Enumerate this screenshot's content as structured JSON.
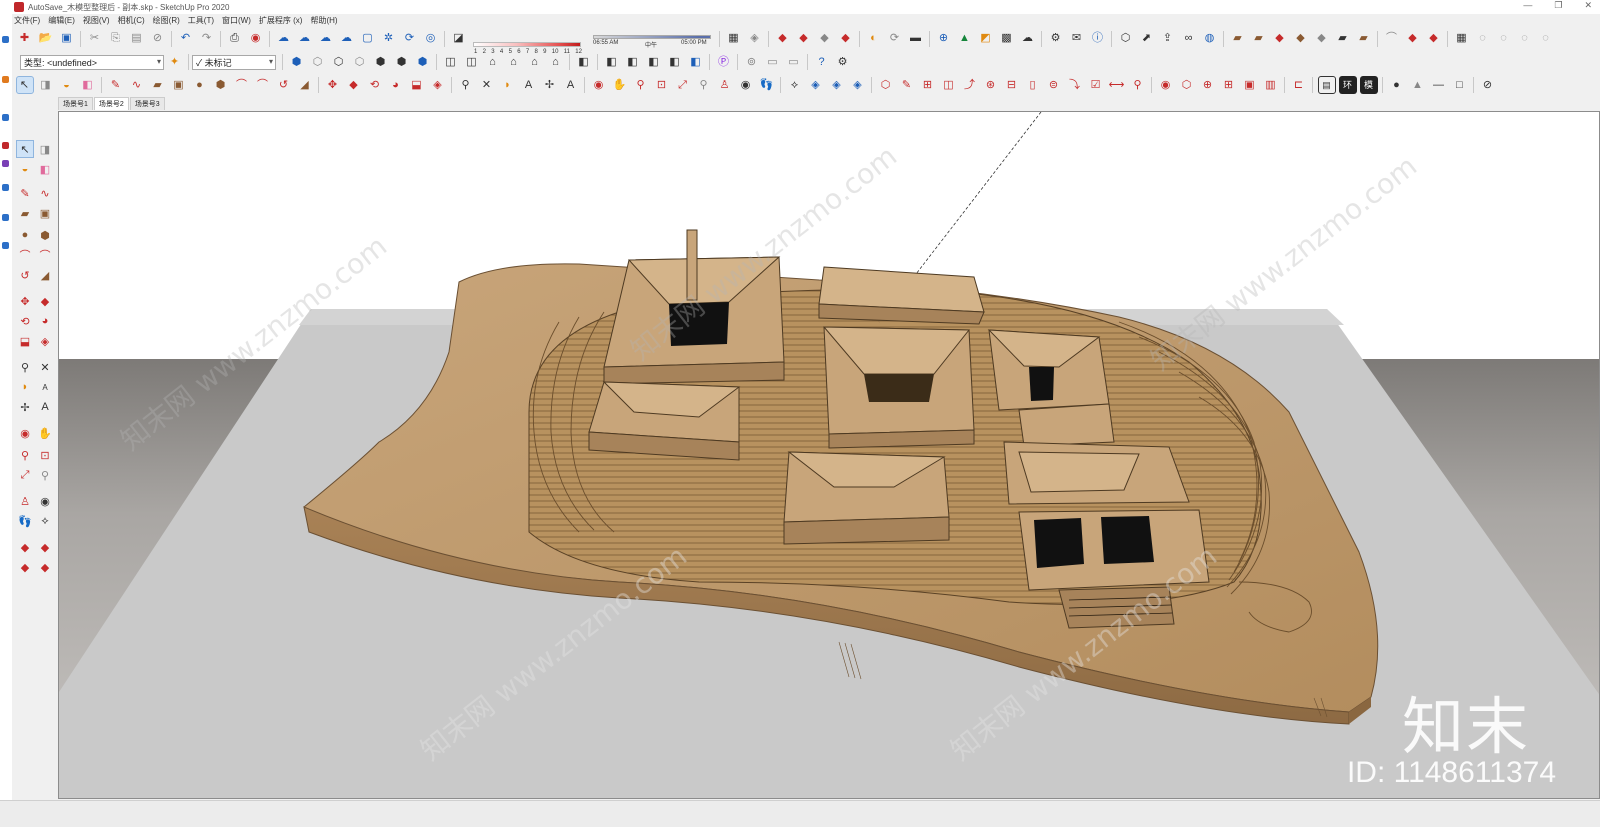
{
  "window": {
    "title": "AutoSave_木模型整理后 - 副本.skp - SketchUp Pro 2020",
    "controls": [
      "—",
      "❐",
      "✕"
    ]
  },
  "menu": [
    "文件(F)",
    "编辑(E)",
    "视图(V)",
    "相机(C)",
    "绘图(R)",
    "工具(T)",
    "窗口(W)",
    "扩展程序 (x)",
    "帮助(H)"
  ],
  "shadow": {
    "month_scale": [
      "1",
      "2",
      "3",
      "4",
      "5",
      "6",
      "7",
      "8",
      "9",
      "10",
      "11",
      "12"
    ],
    "time_start": "06:55 AM",
    "time_mid": "中午",
    "time_end": "05:00 PM"
  },
  "tags": {
    "type_dropdown": "类型: <undefined>",
    "tag_dropdown": "✓ 未标记"
  },
  "scenes": [
    "场景号1",
    "场景号2",
    "场景号3"
  ],
  "active_scene": "场景号2",
  "toolbar_text_buttons": [
    "环",
    "模"
  ],
  "watermark": {
    "logo": "知末",
    "id": "ID: 1148611374",
    "diagonal": "知末网 www.znzmo.com"
  },
  "colors": {
    "wood": "#c8a57a",
    "wood_dark": "#8d6a43",
    "ground": "#c9c9c9",
    "sky": "#ffffff"
  },
  "icons": {
    "toolbar1": [
      "new-icon",
      "open-icon",
      "save-icon",
      "cut-icon",
      "copy-icon",
      "paste-icon",
      "erase-icon",
      "undo-icon",
      "redo-icon",
      "print-icon",
      "model-info-icon",
      "cloud-icon",
      "cloud2-icon",
      "cloud3-icon",
      "cloud4-icon",
      "select-box-icon",
      "gear-icon",
      "chrome-icon",
      "eraser-icon"
    ],
    "left": [
      "select-icon",
      "make-component-icon",
      "paint-icon",
      "eraser-icon",
      "pencil-icon",
      "freehand-icon",
      "rectangle-icon",
      "rotated-rect-icon",
      "circle-icon",
      "polygon-icon",
      "arc-icon",
      "arc2-icon",
      "pie-icon",
      "arc3-icon",
      "move-icon",
      "push-pull-icon",
      "rotate-icon",
      "follow-me-icon",
      "scale-icon",
      "offset-icon",
      "tape-icon",
      "text-icon",
      "protractor-icon",
      "axes-icon",
      "dimension-icon",
      "section-icon",
      "orbit-icon",
      "pan-icon",
      "zoom-icon",
      "zoom-window-icon",
      "zoom-extents-icon",
      "prev-icon",
      "walk-icon",
      "look-around-icon",
      "position-camera-icon",
      "footprints-icon",
      "section-plane-icon",
      "warehouse-icon",
      "extension-icon",
      "ext2-icon",
      "ext3-icon"
    ]
  }
}
